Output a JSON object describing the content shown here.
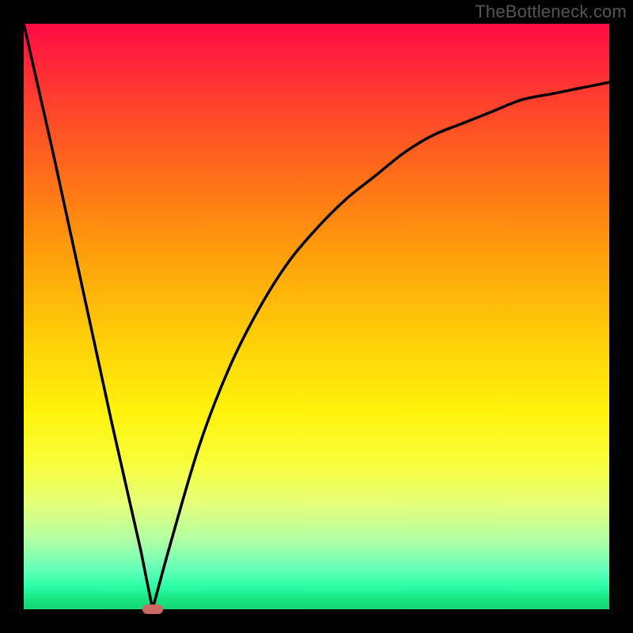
{
  "watermark": "TheBottleneck.com",
  "colors": {
    "frame": "#000000",
    "gradient_top": "#ff0b44",
    "gradient_bottom": "#14d773",
    "curve": "#000000",
    "dot": "#cb6a63"
  },
  "chart_data": {
    "type": "line",
    "title": "",
    "xlabel": "",
    "ylabel": "",
    "xlim": [
      0,
      100
    ],
    "ylim": [
      0,
      100
    ],
    "grid": false,
    "legend": false,
    "note": "V-shaped bottleneck curve. Left of the minimum is approximately linear descending; right of the minimum rises asymptotically toward ~90. Minimum near x≈22, y≈0.",
    "series": [
      {
        "name": "bottleneck",
        "x": [
          0,
          5,
          10,
          15,
          20,
          22,
          25,
          30,
          35,
          40,
          45,
          50,
          55,
          60,
          65,
          70,
          75,
          80,
          85,
          90,
          95,
          100
        ],
        "values": [
          100,
          78,
          55,
          32,
          10,
          0,
          11,
          28,
          41,
          51,
          59,
          65,
          70,
          74,
          78,
          81,
          83,
          85,
          87,
          88,
          89,
          90
        ]
      }
    ],
    "minimum_marker": {
      "x": 22,
      "y": 0
    }
  }
}
